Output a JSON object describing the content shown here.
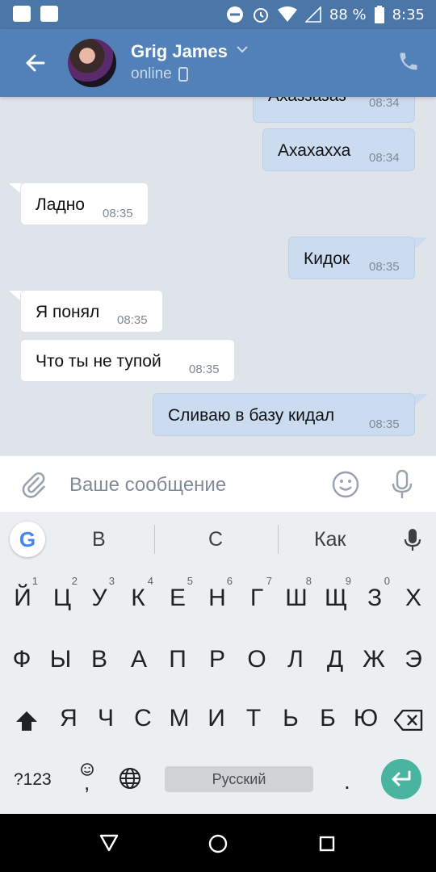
{
  "statusbar": {
    "battery_pct": "88 %",
    "time": "8:35"
  },
  "header": {
    "name": "Grig James",
    "status": "online"
  },
  "messages": [
    {
      "dir": "out",
      "text": "Ахаззазаз",
      "time": "08:34"
    },
    {
      "dir": "out",
      "text": "Ахахахха",
      "time": "08:34"
    },
    {
      "dir": "in",
      "text": "Ладно",
      "time": "08:35"
    },
    {
      "dir": "out",
      "text": "Кидок",
      "time": "08:35"
    },
    {
      "dir": "in",
      "text": "Я понял",
      "time": "08:35"
    },
    {
      "dir": "in",
      "text": "Что ты не тупой",
      "time": "08:35"
    },
    {
      "dir": "out",
      "text": "Сливаю в базу кидал",
      "time": "08:35"
    }
  ],
  "composer": {
    "placeholder": "Ваше сообщение"
  },
  "keyboard": {
    "suggestions": [
      "В",
      "С",
      "Как"
    ],
    "row1": [
      "Й",
      "Ц",
      "У",
      "К",
      "Е",
      "Н",
      "Г",
      "Ш",
      "Щ",
      "З",
      "Х"
    ],
    "row1_hints": [
      "1",
      "2",
      "3",
      "4",
      "5",
      "6",
      "7",
      "8",
      "9",
      "0"
    ],
    "row2": [
      "Ф",
      "Ы",
      "В",
      "А",
      "П",
      "Р",
      "О",
      "Л",
      "Д",
      "Ж",
      "Э"
    ],
    "row3": [
      "Я",
      "Ч",
      "С",
      "М",
      "И",
      "Т",
      "Ь",
      "Б",
      "Ю"
    ],
    "symbols_label": "?123",
    "comma": ",",
    "space_label": "Русский",
    "period": "."
  },
  "colors": {
    "header": "#5181b8",
    "statusbar": "#4a76a8",
    "outgoing_bubble": "#ccdcf0",
    "enter_key": "#49b49f"
  }
}
